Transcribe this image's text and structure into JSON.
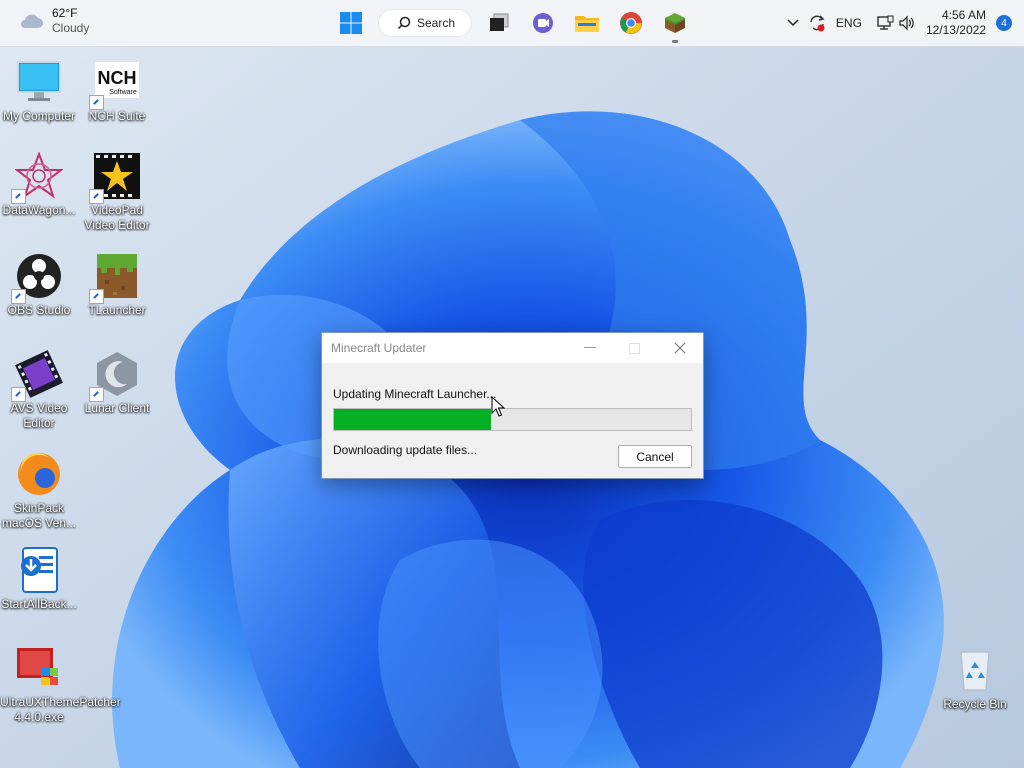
{
  "taskbar": {
    "weather": {
      "temp": "62°F",
      "condition": "Cloudy"
    },
    "search_label": "Search",
    "tray": {
      "language": "ENG",
      "time": "4:56 AM",
      "date": "12/13/2022",
      "notifications": "4"
    }
  },
  "desktop": {
    "icons": [
      {
        "label": "My Computer"
      },
      {
        "label": "NCH Suite"
      },
      {
        "label": "DataWagon..."
      },
      {
        "label": "VideoPad Video Editor"
      },
      {
        "label": "OBS Studio"
      },
      {
        "label": "TLauncher"
      },
      {
        "label": "AVS Video Editor"
      },
      {
        "label": "Lunar Client"
      },
      {
        "label": "SkinPack macOS Ven..."
      },
      {
        "label": "StartAllBack..."
      },
      {
        "label": "UltraUXThemePatcher 4.4.0.exe"
      },
      {
        "label": "Recycle Bin"
      }
    ],
    "nch_logo_text": "NCH",
    "nch_logo_sub": "Software"
  },
  "dialog": {
    "title": "Minecraft Updater",
    "status": "Updating Minecraft Launcher...",
    "progress_percent": 44,
    "substatus": "Downloading update files...",
    "cancel_label": "Cancel"
  },
  "colors": {
    "progress_fill": "#06b025",
    "accent": "#1e6fd9"
  }
}
